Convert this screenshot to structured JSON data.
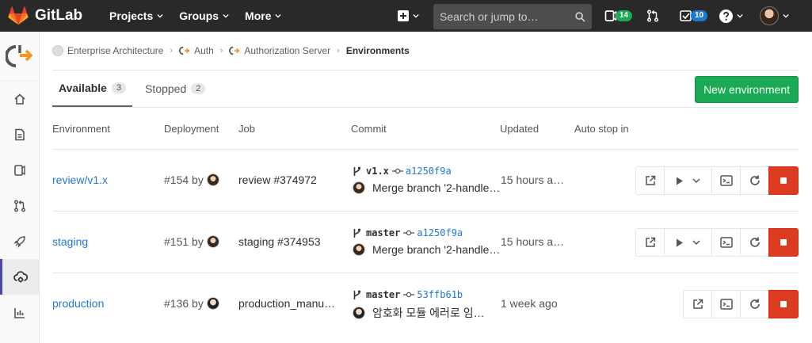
{
  "app": {
    "name": "GitLab"
  },
  "nav": {
    "projects": "Projects",
    "groups": "Groups",
    "more": "More",
    "search_placeholder": "Search or jump to…",
    "todo_count": "14",
    "issues_count": "10"
  },
  "breadcrumb": {
    "group": "Enterprise Architecture",
    "subgroup": "Auth",
    "project": "Authorization Server",
    "current": "Environments"
  },
  "tabs": {
    "available_label": "Available",
    "available_count": "3",
    "stopped_label": "Stopped",
    "stopped_count": "2"
  },
  "new_environment_label": "New environment",
  "table": {
    "headers": {
      "environment": "Environment",
      "deployment": "Deployment",
      "job": "Job",
      "commit": "Commit",
      "updated": "Updated",
      "auto_stop": "Auto stop in"
    },
    "rows": [
      {
        "name": "review/v1.x",
        "deployment": "#154 by",
        "job": "review #374972",
        "ref": "v1.x",
        "sha": "a1250f9a",
        "message": "Merge branch '2-handle…",
        "updated": "15 hours a…"
      },
      {
        "name": "staging",
        "deployment": "#151 by",
        "job": "staging #374953",
        "ref": "master",
        "sha": "a1250f9a",
        "message": "Merge branch '2-handle…",
        "updated": "15 hours a…"
      },
      {
        "name": "production",
        "deployment": "#136 by",
        "job": "production_manu…",
        "ref": "master",
        "sha": "53ffb61b",
        "message": "암호화 모듈 에러로 임…",
        "updated": "1 week ago"
      }
    ]
  },
  "colors": {
    "navbar": "#292929",
    "link": "#1f78d1",
    "success": "#1aaa55",
    "danger": "#db3b21"
  }
}
